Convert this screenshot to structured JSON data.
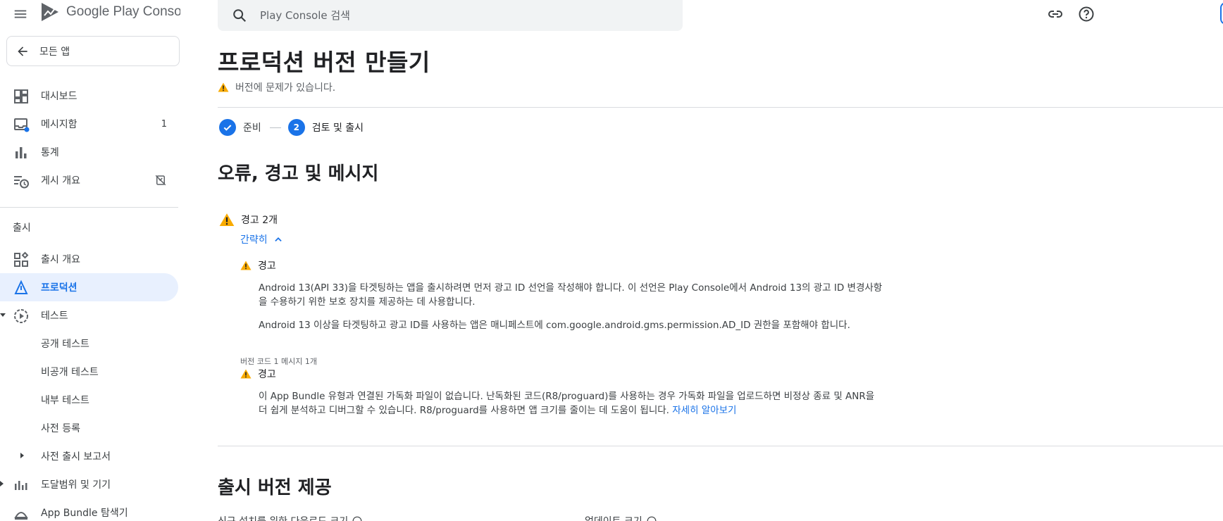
{
  "brand": {
    "name": "Google Play Console"
  },
  "sidebar": {
    "all_apps": "모든 앱",
    "items": [
      {
        "label": "대시보드"
      },
      {
        "label": "메시지함",
        "count": "1"
      },
      {
        "label": "통계"
      },
      {
        "label": "게시 개요"
      }
    ],
    "section": "출시",
    "release_items": [
      {
        "label": "출시 개요"
      },
      {
        "label": "프로덕션"
      },
      {
        "label": "테스트"
      },
      {
        "label": "공개 테스트"
      },
      {
        "label": "비공개 테스트"
      },
      {
        "label": "내부 테스트"
      },
      {
        "label": "사전 등록"
      },
      {
        "label": "사전 출시 보고서"
      },
      {
        "label": "도달범위 및 기기"
      },
      {
        "label": "App Bundle 탐색기"
      }
    ]
  },
  "search": {
    "placeholder": "Play Console 검색"
  },
  "page": {
    "title": "프로덕션 버전 만들기",
    "status": "버전에 문제가 있습니다.",
    "steps": [
      {
        "number": "1",
        "label": "준비",
        "done": true
      },
      {
        "number": "2",
        "label": "검토 및 출시",
        "done": false
      }
    ],
    "errors_section_title": "오류, 경고 및 메시지",
    "warnings_count": "경고 2개",
    "collapse_label": "간략히",
    "warnings": [
      {
        "title": "경고",
        "paragraphs": [
          "Android 13(API 33)을 타겟팅하는 앱을 출시하려면 먼저 광고 ID 선언을 작성해야 합니다. 이 선언은 Play Console에서 Android 13의 광고 ID 변경사항을 수용하기 위한 보호 장치를 제공하는 데 사용합니다.",
          "Android 13 이상을 타겟팅하고 광고 ID를 사용하는 앱은 매니페스트에 com.google.android.gms.permission.AD_ID 권한을 포함해야 합니다."
        ]
      },
      {
        "meta": "버전 코드 1 메시지 1개",
        "title": "경고",
        "text": "이 App Bundle 유형과 연결된 가독화 파일이 없습니다. 난독화된 코드(R8/proguard)를 사용하는 경우 가독화 파일을 업로드하면 비정상 종료 및 ANR을 더 쉽게 분석하고 디버그할 수 있습니다. R8/proguard를 사용하면 앱 크기를 줄이는 데 도움이 됩니다.",
        "link": "자세히 알아보기"
      }
    ],
    "delivery_title": "출시 버전 제공",
    "download_size_label": "신규 설치를 위한 다운로드 크기",
    "update_size_label": "업데이트 크기"
  },
  "colors": {
    "accent": "#1a73e8",
    "warning": "#f9ab00",
    "active_bg": "#e8f0fe"
  }
}
